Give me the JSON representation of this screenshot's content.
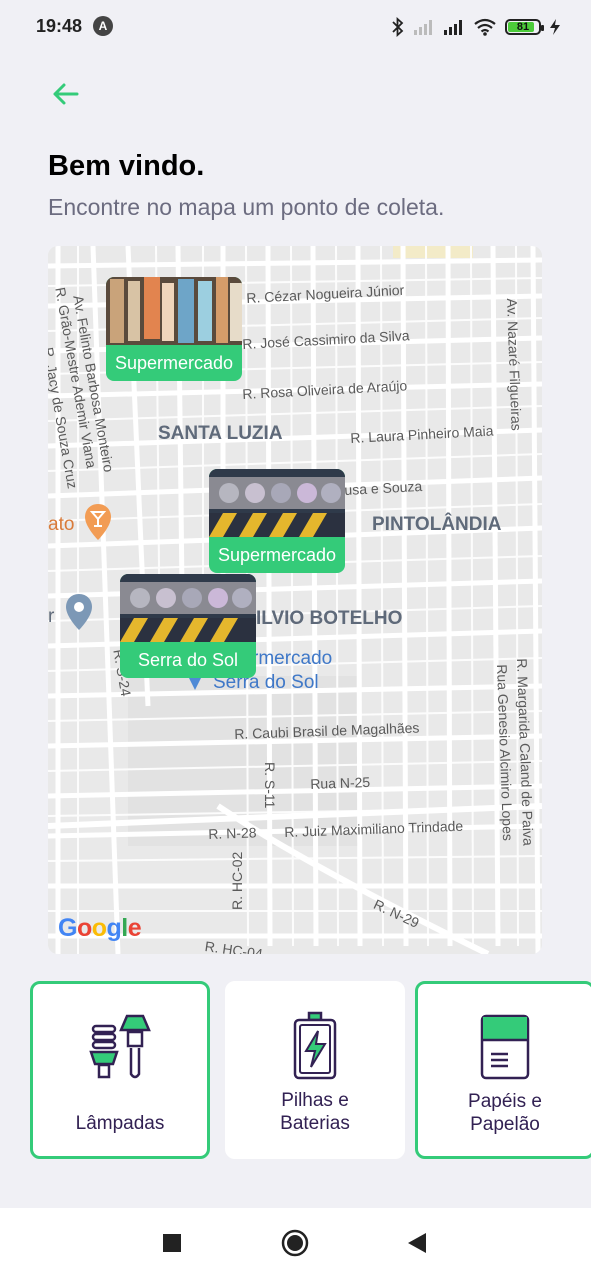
{
  "status_bar": {
    "time": "19:48",
    "app_icon_letter": "A",
    "battery_level": "81",
    "icons": [
      "bluetooth-icon",
      "signal-icon",
      "signal-icon",
      "wifi-icon",
      "battery-icon",
      "charging-icon"
    ]
  },
  "header": {
    "back_icon": "arrow-left-icon",
    "title": "Bem vindo.",
    "subtitle": "Encontre no mapa um ponto de coleta."
  },
  "map": {
    "area_labels": [
      "SANTA LUZIA",
      "PINTOLÂNDIA",
      "ILVIO BOTELHO"
    ],
    "street_labels": [
      "R. Cézar Nogueira Júnior",
      "R. José Cassimiro da Silva",
      "R. Rosa Oliveira de Araújo",
      "R. Laura Pinheiro Maia",
      "usa e Souza",
      "Av. Felinto Barbosa Monteiro",
      "R. Grão-Mestre Ademir Viana",
      "R. Jacy de Souza Cruz",
      "Av. Nazaré Filgueiras",
      "R. Caubi Brasil de Magalhães",
      "R. S-11",
      "Rua N-25",
      "R. N-28",
      "R. Juiz Maximiliano Trindade",
      "R. HC-02",
      "R. N-29",
      "R. HC-04",
      "R. S-24",
      "R. Margarida Caland de Paiva",
      "Rua Genesio Alcimiro Lopes"
    ],
    "poi_labels": [
      "rmercado",
      "Serra do Sol"
    ],
    "edge_labels": [
      "ato",
      "r"
    ],
    "google_logo": "Google",
    "markers": [
      {
        "label": "Supermercado"
      },
      {
        "label": "Supermercado"
      },
      {
        "label": "Serra do Sol"
      }
    ]
  },
  "items": [
    {
      "label": "Lâmpadas",
      "icon": "light-bulbs-icon",
      "selected": true
    },
    {
      "label_line1": "Pilhas e",
      "label_line2": "Baterias",
      "icon": "battery-icon",
      "selected": false
    },
    {
      "label_line1": "Papéis e",
      "label_line2": "Papelão",
      "icon": "paper-icon",
      "selected": true
    }
  ],
  "nav_bar": {
    "icons": [
      "recent-apps-icon",
      "home-icon",
      "back-icon"
    ]
  },
  "colors": {
    "accent": "#34cb79",
    "title": "#000000",
    "subtitle": "#6c6c80",
    "background": "#f0f0f5",
    "card_text": "#322153"
  }
}
